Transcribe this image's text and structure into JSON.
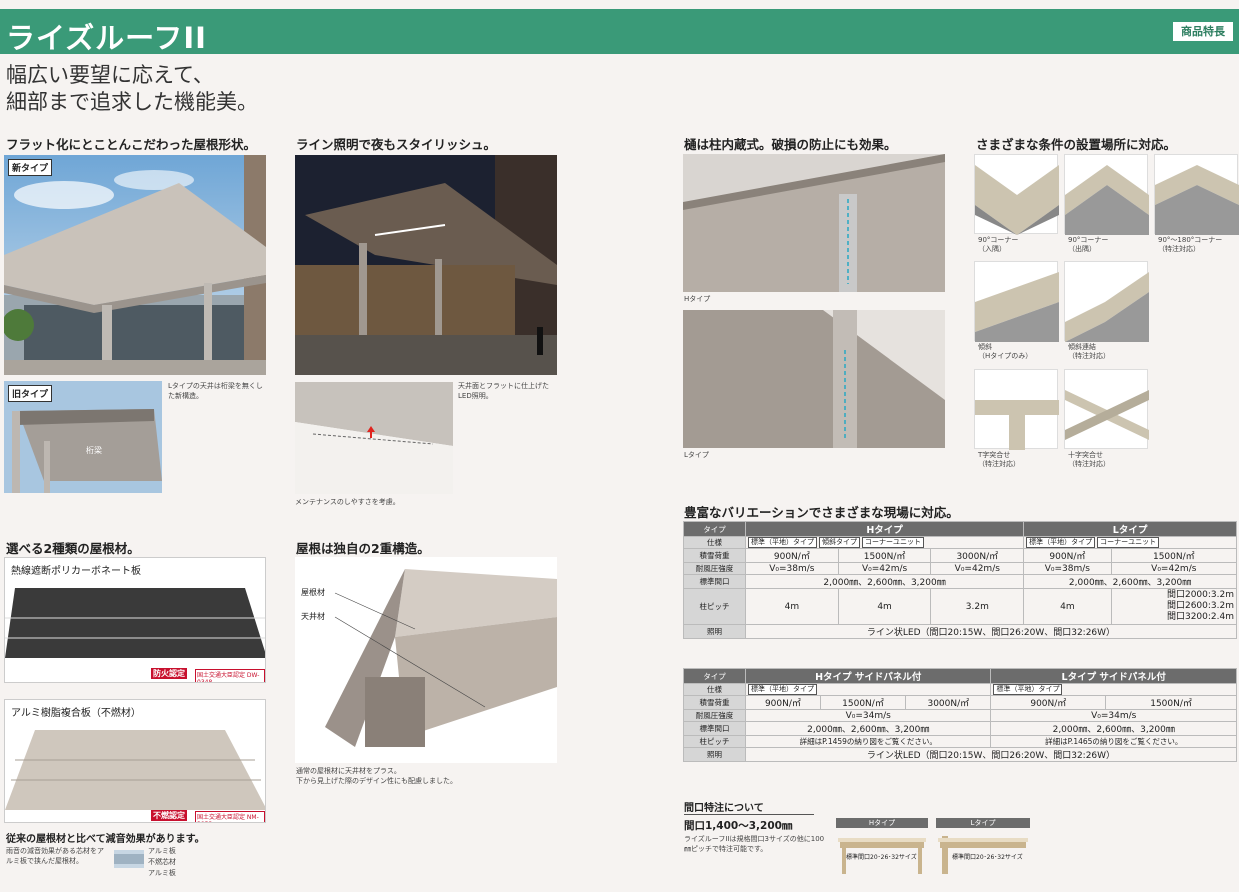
{
  "header": {
    "title": "ライズルーフII",
    "badge": "商品特長",
    "catch": "幅広い要望に応えて、\n細部まで追求した機能美。"
  },
  "sections": {
    "flat": {
      "heading": "フラット化にとことんこだわった屋根形状。",
      "new_tag": "新タイプ",
      "old_tag": "旧タイプ",
      "old_label": "桁梁",
      "caption": "Lタイプの天井は桁梁を無くした新構造。"
    },
    "lighting": {
      "heading": "ライン照明で夜もスタイリッシュ。",
      "caption1": "天井面とフラットに仕上げたLED照明。",
      "caption2": "メンテナンスのしやすさを考慮。"
    },
    "gutter": {
      "heading": "樋は柱内蔵式。破損の防止にも効果。",
      "h_label": "Hタイプ",
      "l_label": "Lタイプ"
    },
    "conditions": {
      "heading": "さまざまな条件の設置場所に対応。",
      "items": [
        {
          "caption": "90°コーナー\n（入隅）"
        },
        {
          "caption": "90°コーナー\n（出隅）"
        },
        {
          "caption": "90°〜180°コーナー\n（特注対応）"
        },
        {
          "caption": "傾斜\n（Hタイプのみ）"
        },
        {
          "caption": "傾斜連結\n（特注対応）"
        },
        {
          "caption": "T字突合せ\n（特注対応）"
        },
        {
          "caption": "十字突合せ\n（特注対応）"
        }
      ]
    },
    "roofing": {
      "heading": "選べる2種類の屋根材。",
      "pc_label": "熱線遮断ポリカーボネート板",
      "pc_cert": "防火認定",
      "pc_cert_no": "国土交通大臣認定 DW-0348",
      "alu_label": "アルミ樹脂複合板（不燃材）",
      "alu_cert": "不燃認定",
      "alu_cert_no": "国土交通大臣認定 NM-3853",
      "note": "従来の屋根材と比べて減音効果があります。",
      "note_caption": "雨音の減音効果がある芯材をアルミ板で挟んだ屋根材。",
      "layers": [
        "アルミ板",
        "不燃芯材",
        "アルミ板"
      ]
    },
    "structure": {
      "heading": "屋根は独自の2重構造。",
      "roof_label": "屋根材",
      "ceiling_label": "天井材",
      "caption": "通常の屋根材に天井材をプラス。\n下から見上げた際のデザイン性にも配慮しました。"
    },
    "variation": {
      "heading": "豊富なバリエーションでさまざまな現場に対応。",
      "table1": {
        "type_label": "タイプ",
        "h_head": "Hタイプ",
        "l_head": "Lタイプ",
        "rows": {
          "spec_label": "仕様",
          "h_specs": [
            "標準（平地）タイプ",
            "傾斜タイプ",
            "コーナーユニット"
          ],
          "l_specs": [
            "標準（平地）タイプ",
            "コーナーユニット"
          ],
          "snow_label": "積雪荷重",
          "h_snow": [
            "900N/㎡",
            "1500N/㎡",
            "3000N/㎡"
          ],
          "l_snow": [
            "900N/㎡",
            "1500N/㎡"
          ],
          "wind_label": "耐風圧強度",
          "h_wind": [
            "V₀=38m/s",
            "V₀=42m/s",
            "V₀=42m/s"
          ],
          "l_wind": [
            "V₀=38m/s",
            "V₀=42m/s"
          ],
          "width_label": "標準間口",
          "h_width": "2,000㎜、2,600㎜、3,200㎜",
          "l_width": "2,000㎜、2,600㎜、3,200㎜",
          "pitch_label": "柱ピッチ",
          "h_pitch": [
            "4m",
            "4m",
            "3.2m"
          ],
          "l_pitch1": "4m",
          "l_pitch2": [
            "間口2000:3.2m",
            "間口2600:3.2m",
            "間口3200:2.4m"
          ],
          "light_label": "照明",
          "light": "ライン状LED（間口20:15W、間口26:20W、間口32:26W）"
        }
      },
      "table2": {
        "type_label": "タイプ",
        "h_head": "Hタイプ サイドパネル付",
        "l_head": "Lタイプ サイドパネル付",
        "spec_label": "仕様",
        "h_spec": "標準（平地）タイプ",
        "l_spec": "標準（平地）タイプ",
        "snow_label": "積雪荷重",
        "h_snow": [
          "900N/㎡",
          "1500N/㎡",
          "3000N/㎡"
        ],
        "l_snow": [
          "900N/㎡",
          "1500N/㎡"
        ],
        "wind_label": "耐風圧強度",
        "h_wind": "V₀=34m/s",
        "l_wind": "V₀=34m/s",
        "width_label": "標準間口",
        "h_width": "2,000㎜、2,600㎜、3,200㎜",
        "l_width": "2,000㎜、2,600㎜、3,200㎜",
        "pitch_label": "柱ピッチ",
        "h_pitch": "詳細はP.1459の納り図をご覧ください。",
        "l_pitch": "詳細はP.1465の納り図をご覧ください。",
        "light_label": "照明",
        "light": "ライン状LED（間口20:15W、間口26:20W、間口32:26W）"
      }
    },
    "special": {
      "heading": "間口特注について",
      "range": "間口1,400〜3,200㎜",
      "caption": "ライズルーフIIは規格間口3サイズの他に100㎜ピッチで特注可能です。",
      "h_label": "Hタイプ",
      "l_label": "Lタイプ",
      "h_inner": "標準間口20･26･32サイズ",
      "l_inner": "標準間口20･26･32サイズ"
    }
  }
}
